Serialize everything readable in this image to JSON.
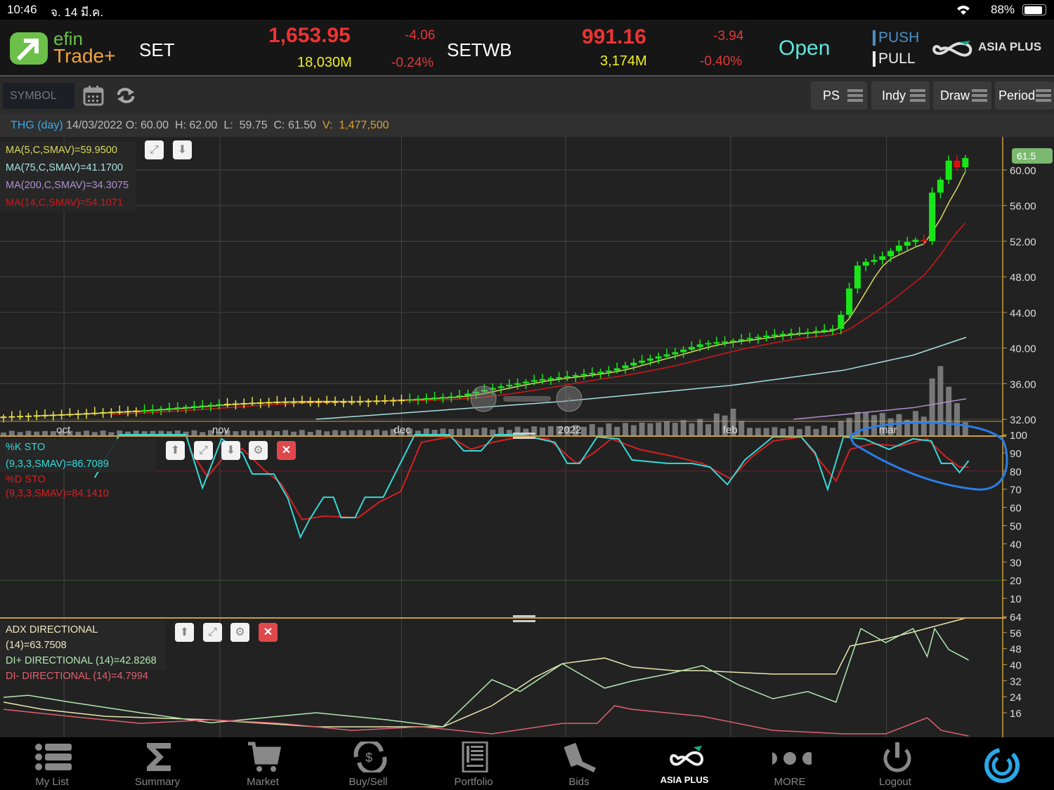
{
  "status_bar": {
    "time": "10:46",
    "date": "จ. 14 มี.ค.",
    "battery": "88%"
  },
  "header": {
    "logo_top": "efin",
    "logo_bottom": "Trade+",
    "indices": [
      {
        "name": "SET",
        "value": "1,653.95",
        "change": "-4.06",
        "volume": "18,030M",
        "percent": "-0.24%"
      },
      {
        "name": "SETWB",
        "value": "991.16",
        "change": "-3.94",
        "volume": "3,174M",
        "percent": "-0.40%"
      }
    ],
    "market_status": "Open",
    "push": "PUSH",
    "pull": "PULL",
    "broker": "ASIA PLUS"
  },
  "toolbar": {
    "symbol_placeholder": "SYMBOL",
    "buttons": [
      "PS",
      "Indy",
      "Draw",
      "Period"
    ]
  },
  "info": {
    "symbol": "THG (day)",
    "date": "14/03/2022",
    "o_label": "O:",
    "o": "60.00",
    "h_label": "H:",
    "h": "62.00",
    "l_label": "L:",
    "l": "59.75",
    "c_label": "C:",
    "c": "61.50",
    "v_label": "V:",
    "v": "1,477,500"
  },
  "colors": {
    "up": "#19e619",
    "down": "#e01010",
    "ma5": "#d8d860",
    "ma75": "#a8e0e0",
    "ma200": "#b090d0",
    "ma14": "#d01818",
    "k": "#38d8d8",
    "d": "#d82020",
    "adx": "#e8e8b0",
    "diplus": "#b0e8b0",
    "diminus": "#e06070",
    "axis": "#c8a040"
  },
  "chart_data": [
    {
      "type": "candlestick",
      "title": "THG (day)",
      "legend": [
        "MA(5,C,SMAV)=59.9500",
        "MA(75,C,SMAV)=41.1700",
        "MA(200,C,SMAV)=34.3075",
        "MA(14,C,SMAV)=54.1071"
      ],
      "last_price_tag": "61.5",
      "x_ticks": [
        {
          "d": 7.3,
          "label": "oct"
        },
        {
          "d": 26.1,
          "label": "nov"
        },
        {
          "d": 48,
          "label": "dec"
        },
        {
          "d": 67.8,
          "label": "2022"
        },
        {
          "d": 87.7,
          "label": "feb"
        },
        {
          "d": 106.5,
          "label": "mar"
        }
      ],
      "y_ticks": [
        "60.00",
        "56.00",
        "52.00",
        "48.00",
        "44.00",
        "40.00",
        "36.00",
        "32.00"
      ],
      "ylim": [
        31.5,
        63.5
      ],
      "close_keypoints": [
        [
          0,
          32.3
        ],
        [
          8,
          32.6
        ],
        [
          16.5,
          33
        ],
        [
          26.1,
          33.7
        ],
        [
          33.5,
          34
        ],
        [
          42,
          34
        ],
        [
          48,
          34.2
        ],
        [
          54.7,
          34.6
        ],
        [
          58.9,
          35.5
        ],
        [
          64,
          36.4
        ],
        [
          67.8,
          36.8
        ],
        [
          73.3,
          37.5
        ],
        [
          75.8,
          38.3
        ],
        [
          80.9,
          39.5
        ],
        [
          84.3,
          40.5
        ],
        [
          87.7,
          40.8
        ],
        [
          92.8,
          41.5
        ],
        [
          97,
          41.8
        ],
        [
          100.4,
          42.2
        ],
        [
          101.3,
          44.5
        ],
        [
          102.1,
          47
        ],
        [
          103.1,
          49.5
        ],
        [
          105.5,
          50
        ],
        [
          108,
          51.5
        ],
        [
          109.7,
          52.2
        ],
        [
          111,
          52
        ],
        [
          112.1,
          58
        ],
        [
          113.1,
          59
        ],
        [
          114.2,
          61.5
        ],
        [
          115.2,
          60
        ],
        [
          116.1,
          61.5
        ]
      ],
      "ma75_keypoints": [
        [
          37.7,
          32
        ],
        [
          67.4,
          34
        ],
        [
          87.7,
          35.8
        ],
        [
          101.3,
          37.5
        ],
        [
          109.7,
          39.2
        ],
        [
          116.1,
          41.2
        ]
      ],
      "ma200_keypoints": [
        [
          95.3,
          32
        ],
        [
          109.7,
          33.3
        ],
        [
          116.1,
          34.3
        ]
      ],
      "volume_keypoints": [
        [
          0,
          0.06
        ],
        [
          40,
          0.07
        ],
        [
          60,
          0.1
        ],
        [
          75,
          0.15
        ],
        [
          85,
          0.2
        ],
        [
          87.7,
          0.35
        ],
        [
          90,
          0.1
        ],
        [
          100,
          0.12
        ],
        [
          103,
          0.3
        ],
        [
          108,
          0.25
        ],
        [
          111,
          0.3
        ],
        [
          112.1,
          0.7
        ],
        [
          113.1,
          1.0
        ],
        [
          114.2,
          0.5
        ],
        [
          115.2,
          0.4
        ],
        [
          116.1,
          0.15
        ]
      ]
    },
    {
      "type": "line",
      "title": "Stochastic",
      "legend": [
        "%K STO (9,3,3,SMAV)=86.7089",
        "%D STO (9,3,3,SMAV)=84.1410"
      ],
      "y_ticks": [
        "100",
        "90",
        "80",
        "70",
        "60",
        "50",
        "40",
        "30",
        "20",
        "10"
      ],
      "ylim": [
        0,
        100
      ],
      "series": [
        {
          "name": "%K",
          "points": [
            [
              11,
              76.4
            ],
            [
              14,
              100
            ],
            [
              22,
              100
            ],
            [
              24,
              70.7
            ],
            [
              26.3,
              97.7
            ],
            [
              28.8,
              90
            ],
            [
              30,
              78.4
            ],
            [
              32.6,
              78.4
            ],
            [
              34.3,
              64.9
            ],
            [
              35.8,
              43.6
            ],
            [
              36.9,
              53.3
            ],
            [
              38.6,
              65.6
            ],
            [
              39.8,
              65.6
            ],
            [
              40.7,
              54.4
            ],
            [
              42.4,
              54.4
            ],
            [
              43.6,
              65.6
            ],
            [
              45.8,
              65.6
            ],
            [
              49.6,
              100
            ],
            [
              53.8,
              100
            ],
            [
              55.5,
              91.1
            ],
            [
              57.6,
              91.1
            ],
            [
              59.3,
              100
            ],
            [
              62.3,
              100
            ],
            [
              66.5,
              95.8
            ],
            [
              68,
              84.2
            ],
            [
              69.5,
              84.2
            ],
            [
              71.6,
              98.8
            ],
            [
              74.2,
              97.7
            ],
            [
              75.8,
              86.1
            ],
            [
              80.1,
              84.2
            ],
            [
              83,
              84.2
            ],
            [
              85.2,
              82.2
            ],
            [
              87.3,
              72.6
            ],
            [
              89.4,
              86.1
            ],
            [
              92.8,
              98.8
            ],
            [
              96.2,
              98.8
            ],
            [
              97.9,
              90
            ],
            [
              99.4,
              69.9
            ],
            [
              101.3,
              98.8
            ],
            [
              103.8,
              97.7
            ],
            [
              106.8,
              91.9
            ],
            [
              109.7,
              97.7
            ],
            [
              111.9,
              96.5
            ],
            [
              113.1,
              84.2
            ],
            [
              114.4,
              84.2
            ],
            [
              115.3,
              79.2
            ],
            [
              116.4,
              85.7
            ]
          ]
        },
        {
          "name": "%D",
          "points": [
            [
              22.4,
              92.3
            ],
            [
              24.6,
              76.8
            ],
            [
              26.7,
              88.4
            ],
            [
              28.8,
              92.3
            ],
            [
              31.4,
              80.7
            ],
            [
              33.5,
              73
            ],
            [
              36,
              53.3
            ],
            [
              38.6,
              55.2
            ],
            [
              42.8,
              54.4
            ],
            [
              45.3,
              62.9
            ],
            [
              47.9,
              68.7
            ],
            [
              50.4,
              95.8
            ],
            [
              53.8,
              98.8
            ],
            [
              56.4,
              91.9
            ],
            [
              59,
              95.8
            ],
            [
              62.3,
              98.8
            ],
            [
              65.7,
              97.7
            ],
            [
              69.1,
              84.2
            ],
            [
              71.2,
              90
            ],
            [
              73.3,
              97.7
            ],
            [
              76.7,
              91.9
            ],
            [
              80.9,
              88
            ],
            [
              84.3,
              84.2
            ],
            [
              87.7,
              75.7
            ],
            [
              90.3,
              88
            ],
            [
              92.8,
              96.5
            ],
            [
              96.2,
              98.8
            ],
            [
              98.7,
              84.2
            ],
            [
              100.4,
              74.5
            ],
            [
              102.1,
              91.9
            ],
            [
              104.7,
              95
            ],
            [
              108.1,
              93.8
            ],
            [
              111.4,
              97.7
            ],
            [
              113.6,
              88
            ],
            [
              115.3,
              82.2
            ],
            [
              116.4,
              82.2
            ]
          ]
        }
      ]
    },
    {
      "type": "line",
      "title": "ADX Directional",
      "legend": [
        "ADX DIRECTIONAL (14)=63.7508",
        "DI+ DIRECTIONAL (14)=42.8268",
        "DI- DIRECTIONAL (14)=4.7994"
      ],
      "y_ticks": [
        "64",
        "56",
        "48",
        "40",
        "32",
        "24",
        "16"
      ],
      "ylim": [
        0,
        64
      ],
      "series": [
        {
          "name": "ADX",
          "points": [
            [
              0,
              21.3
            ],
            [
              4.7,
              17.7
            ],
            [
              12.3,
              14.2
            ],
            [
              25,
              12.5
            ],
            [
              37.7,
              9
            ],
            [
              53,
              9
            ],
            [
              58.9,
              19.5
            ],
            [
              64,
              33.5
            ],
            [
              67.4,
              40.5
            ],
            [
              72.5,
              43.3
            ],
            [
              75.8,
              38.8
            ],
            [
              80.9,
              37
            ],
            [
              84.3,
              37
            ],
            [
              92.8,
              35.3
            ],
            [
              100.4,
              35.3
            ],
            [
              102.1,
              49.3
            ],
            [
              106.4,
              52.8
            ],
            [
              109.7,
              56.3
            ],
            [
              116.1,
              63.3
            ]
          ]
        },
        {
          "name": "DI+",
          "points": [
            [
              0,
              23.7
            ],
            [
              3,
              24.7
            ],
            [
              8,
              21.3
            ],
            [
              16.5,
              16
            ],
            [
              25,
              11
            ],
            [
              37.7,
              16
            ],
            [
              46.2,
              12.5
            ],
            [
              53,
              9
            ],
            [
              58.9,
              32.5
            ],
            [
              62.3,
              26.6
            ],
            [
              67.4,
              40.5
            ],
            [
              72.5,
              28.3
            ],
            [
              75.8,
              31.8
            ],
            [
              80.1,
              35.3
            ],
            [
              84.3,
              39.5
            ],
            [
              88.6,
              30
            ],
            [
              92.8,
              23
            ],
            [
              97,
              26.6
            ],
            [
              100.4,
              21.3
            ],
            [
              103.4,
              58
            ],
            [
              106.4,
              51
            ],
            [
              109.7,
              58
            ],
            [
              111.4,
              44
            ],
            [
              112.3,
              58
            ],
            [
              114,
              47.5
            ],
            [
              116.4,
              42.3
            ]
          ]
        },
        {
          "name": "DI-",
          "points": [
            [
              0,
              17.7
            ],
            [
              8,
              14.2
            ],
            [
              16.5,
              10.7
            ],
            [
              25,
              12.5
            ],
            [
              33.5,
              10.7
            ],
            [
              42,
              7.2
            ],
            [
              50.4,
              9
            ],
            [
              58.9,
              5.5
            ],
            [
              67.4,
              10.7
            ],
            [
              71.6,
              10.7
            ],
            [
              73.7,
              19.5
            ],
            [
              75.8,
              17.7
            ],
            [
              84.3,
              14.2
            ],
            [
              92.8,
              7.2
            ],
            [
              101.3,
              5.5
            ],
            [
              106.4,
              5.5
            ],
            [
              111.4,
              13.5
            ],
            [
              113.1,
              7.2
            ],
            [
              116.4,
              4.4
            ]
          ]
        }
      ]
    }
  ],
  "nav": [
    "My List",
    "Summary",
    "Market",
    "Buy/Sell",
    "Portfolio",
    "Bids",
    "ASIA PLUS",
    "MORE",
    "Logout"
  ]
}
